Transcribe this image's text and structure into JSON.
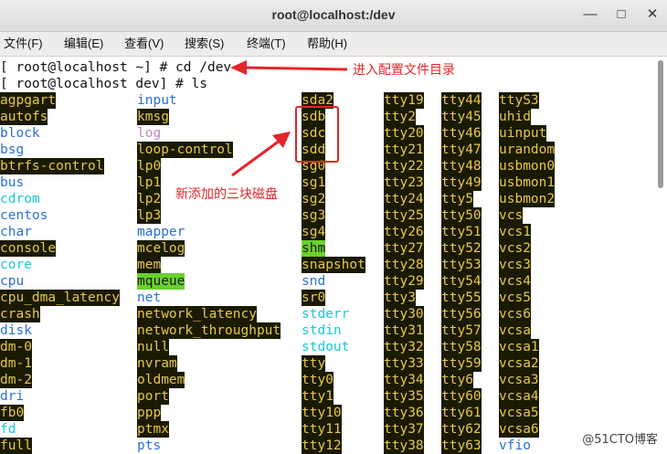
{
  "window": {
    "title": "root@localhost:/dev"
  },
  "menu": [
    "文件(F)",
    "编辑(E)",
    "查看(V)",
    "搜索(S)",
    "终端(T)",
    "帮助(H)"
  ],
  "prompts": [
    "[ root@localhost ~] # cd /dev",
    "[ root@localhost dev] # ls"
  ],
  "columns": [
    [
      [
        "agpgart",
        "hl"
      ],
      [
        "autofs",
        "hl"
      ],
      [
        "block",
        "blue"
      ],
      [
        "bsg",
        "blue"
      ],
      [
        "btrfs-control",
        "hl"
      ],
      [
        "bus",
        "blue"
      ],
      [
        "cdrom",
        "cyan"
      ],
      [
        "centos",
        "blue"
      ],
      [
        "char",
        "blue"
      ],
      [
        "console",
        "hl"
      ],
      [
        "core",
        "cyan"
      ],
      [
        "cpu",
        "blue"
      ],
      [
        "cpu_dma_latency",
        "hl"
      ],
      [
        "crash",
        "hl"
      ],
      [
        "disk",
        "blue"
      ],
      [
        "dm-0",
        "hl"
      ],
      [
        "dm-1",
        "hl"
      ],
      [
        "dm-2",
        "hl"
      ],
      [
        "dri",
        "blue"
      ],
      [
        "fb0",
        "hl"
      ],
      [
        "fd",
        "cyan"
      ],
      [
        "full",
        "hl"
      ]
    ],
    [
      [
        "input",
        "blue"
      ],
      [
        "kmsg",
        "hl"
      ],
      [
        "log",
        "mag"
      ],
      [
        "loop-control",
        "hl"
      ],
      [
        "lp0",
        "hl"
      ],
      [
        "lp1",
        "hl"
      ],
      [
        "lp2",
        "hl"
      ],
      [
        "lp3",
        "hl"
      ],
      [
        "mapper",
        "blue"
      ],
      [
        "mcelog",
        "hl"
      ],
      [
        "mem",
        "hl"
      ],
      [
        "mqueue",
        "grn"
      ],
      [
        "net",
        "blue"
      ],
      [
        "network_latency",
        "hl"
      ],
      [
        "network_throughput",
        "hl"
      ],
      [
        "null",
        "hl"
      ],
      [
        "nvram",
        "hl"
      ],
      [
        "oldmem",
        "hl"
      ],
      [
        "port",
        "hl"
      ],
      [
        "ppp",
        "hl"
      ],
      [
        "ptmx",
        "hl"
      ],
      [
        "pts",
        "blue"
      ]
    ],
    [
      [
        "sda2",
        "hl"
      ],
      [
        "sdb",
        "hl"
      ],
      [
        "sdc",
        "hl"
      ],
      [
        "sdd",
        "hl"
      ],
      [
        "sg0",
        "hl"
      ],
      [
        "sg1",
        "hl"
      ],
      [
        "sg2",
        "hl"
      ],
      [
        "sg3",
        "hl"
      ],
      [
        "sg4",
        "hl"
      ],
      [
        "shm",
        "grn"
      ],
      [
        "snapshot",
        "hl"
      ],
      [
        "snd",
        "blue"
      ],
      [
        "sr0",
        "hl"
      ],
      [
        "stderr",
        "cyan"
      ],
      [
        "stdin",
        "cyan"
      ],
      [
        "stdout",
        "cyan"
      ],
      [
        "tty",
        "hl"
      ],
      [
        "tty0",
        "hl"
      ],
      [
        "tty1",
        "hl"
      ],
      [
        "tty10",
        "hl"
      ],
      [
        "tty11",
        "hl"
      ],
      [
        "tty12",
        "hl"
      ]
    ],
    [
      [
        "tty19",
        "hl"
      ],
      [
        "tty2",
        "hl"
      ],
      [
        "tty20",
        "hl"
      ],
      [
        "tty21",
        "hl"
      ],
      [
        "tty22",
        "hl"
      ],
      [
        "tty23",
        "hl"
      ],
      [
        "tty24",
        "hl"
      ],
      [
        "tty25",
        "hl"
      ],
      [
        "tty26",
        "hl"
      ],
      [
        "tty27",
        "hl"
      ],
      [
        "tty28",
        "hl"
      ],
      [
        "tty29",
        "hl"
      ],
      [
        "tty3",
        "hl"
      ],
      [
        "tty30",
        "hl"
      ],
      [
        "tty31",
        "hl"
      ],
      [
        "tty32",
        "hl"
      ],
      [
        "tty33",
        "hl"
      ],
      [
        "tty34",
        "hl"
      ],
      [
        "tty35",
        "hl"
      ],
      [
        "tty36",
        "hl"
      ],
      [
        "tty37",
        "hl"
      ],
      [
        "tty38",
        "hl"
      ]
    ],
    [
      [
        "tty44",
        "hl"
      ],
      [
        "tty45",
        "hl"
      ],
      [
        "tty46",
        "hl"
      ],
      [
        "tty47",
        "hl"
      ],
      [
        "tty48",
        "hl"
      ],
      [
        "tty49",
        "hl"
      ],
      [
        "tty5",
        "hl"
      ],
      [
        "tty50",
        "hl"
      ],
      [
        "tty51",
        "hl"
      ],
      [
        "tty52",
        "hl"
      ],
      [
        "tty53",
        "hl"
      ],
      [
        "tty54",
        "hl"
      ],
      [
        "tty55",
        "hl"
      ],
      [
        "tty56",
        "hl"
      ],
      [
        "tty57",
        "hl"
      ],
      [
        "tty58",
        "hl"
      ],
      [
        "tty59",
        "hl"
      ],
      [
        "tty6",
        "hl"
      ],
      [
        "tty60",
        "hl"
      ],
      [
        "tty61",
        "hl"
      ],
      [
        "tty62",
        "hl"
      ],
      [
        "tty63",
        "hl"
      ]
    ],
    [
      [
        "ttyS3",
        "hl"
      ],
      [
        "uhid",
        "hl"
      ],
      [
        "uinput",
        "hl"
      ],
      [
        "urandom",
        "hl"
      ],
      [
        "usbmon0",
        "hl"
      ],
      [
        "usbmon1",
        "hl"
      ],
      [
        "usbmon2",
        "hl"
      ],
      [
        "vcs",
        "hl"
      ],
      [
        "vcs1",
        "hl"
      ],
      [
        "vcs2",
        "hl"
      ],
      [
        "vcs3",
        "hl"
      ],
      [
        "vcs4",
        "hl"
      ],
      [
        "vcs5",
        "hl"
      ],
      [
        "vcs6",
        "hl"
      ],
      [
        "vcsa",
        "hl"
      ],
      [
        "vcsa1",
        "hl"
      ],
      [
        "vcsa2",
        "hl"
      ],
      [
        "vcsa3",
        "hl"
      ],
      [
        "vcsa4",
        "hl"
      ],
      [
        "vcsa5",
        "hl"
      ],
      [
        "vcsa6",
        "hl"
      ],
      [
        "vfio",
        "blue"
      ]
    ]
  ],
  "annotations": {
    "enter_config": "进入配置文件目录",
    "new_disks": "新添加的三块磁盘"
  },
  "watermark": "@51CTO博客",
  "colors": {
    "highlight_bg": "#1a1a00",
    "highlight_fg": "#e7c74a",
    "annotation": "#e4252a"
  }
}
